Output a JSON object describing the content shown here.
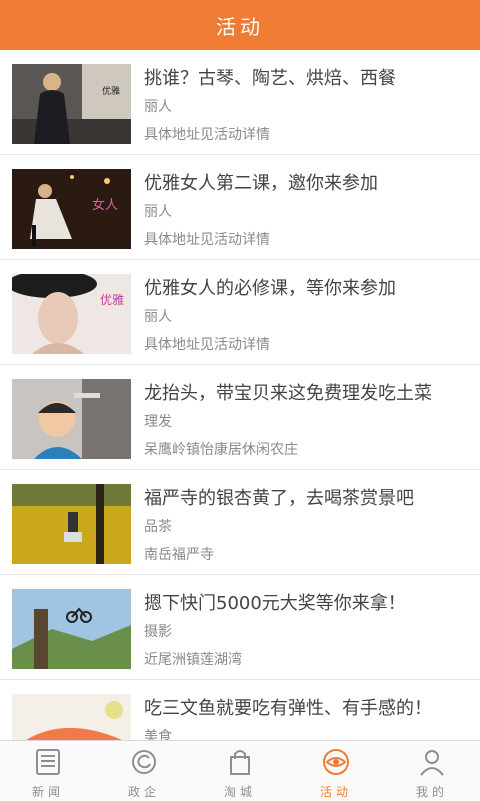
{
  "header": {
    "title": "活动"
  },
  "items": [
    {
      "title": "挑谁？古琴、陶艺、烘焙、西餐",
      "category": "丽人",
      "address": "具体地址见活动详情"
    },
    {
      "title": "优雅女人第二课，邀你来参加",
      "category": "丽人",
      "address": "具体地址见活动详情"
    },
    {
      "title": "优雅女人的必修课，等你来参加",
      "category": "丽人",
      "address": "具体地址见活动详情"
    },
    {
      "title": "龙抬头，带宝贝来这免费理发吃土菜",
      "category": "理发",
      "address": "呆鹰岭镇怡康居休闲农庄"
    },
    {
      "title": "福严寺的银杏黄了，去喝茶赏景吧",
      "category": "品茶",
      "address": "南岳福严寺"
    },
    {
      "title": "摁下快门5000元大奖等你来拿！",
      "category": "摄影",
      "address": "近尾洲镇莲湖湾"
    },
    {
      "title": "吃三文鱼就要吃有弹性、有手感的！",
      "category": "美食",
      "address": ""
    }
  ],
  "tabs": [
    {
      "label": "新闻",
      "icon": "newspaper-icon"
    },
    {
      "label": "政企",
      "icon": "government-icon"
    },
    {
      "label": "淘城",
      "icon": "shopping-bag-icon"
    },
    {
      "label": "活动",
      "icon": "eye-icon",
      "active": true
    },
    {
      "label": "我的",
      "icon": "user-icon"
    }
  ],
  "colors": {
    "accent": "#ef7c35",
    "text": "#444444",
    "muted": "#8a8a8a"
  }
}
